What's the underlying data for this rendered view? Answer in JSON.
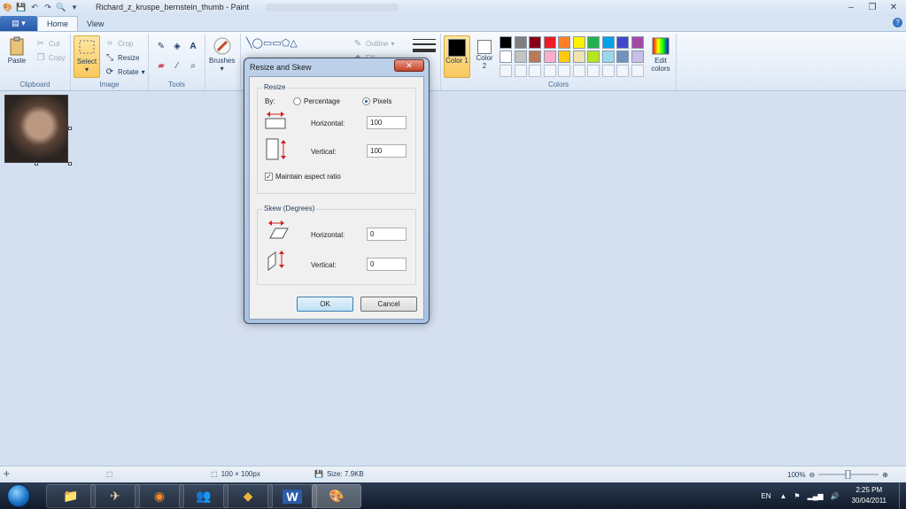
{
  "window": {
    "title": "Richard_z_kruspe_bernstein_thumb - Paint",
    "controls": {
      "minimize": "–",
      "maximize": "❐",
      "close": "✕"
    }
  },
  "tabs": {
    "app_menu": "▤ ▾",
    "home": "Home",
    "view": "View",
    "help": "?"
  },
  "ribbon": {
    "clipboard": {
      "label": "Clipboard",
      "paste": "Paste",
      "cut": "Cut",
      "copy": "Copy"
    },
    "image": {
      "label": "Image",
      "select": "Select",
      "crop": "Crop",
      "resize": "Resize",
      "rotate": "Rotate"
    },
    "tools": {
      "label": "Tools"
    },
    "brushes": {
      "label": "Brushes"
    },
    "shapes": {
      "outline": "Outline",
      "fill": "Fill"
    },
    "colors": {
      "label": "Colors",
      "color1": "Color 1",
      "color2": "Color 2",
      "edit": "Edit colors",
      "palette_row1": [
        "#000000",
        "#7f7f7f",
        "#880015",
        "#ed1c24",
        "#ff7f27",
        "#fff200",
        "#22b14c",
        "#00a2e8",
        "#3f48cc",
        "#a349a4"
      ],
      "palette_row2": [
        "#ffffff",
        "#c3c3c3",
        "#b97a57",
        "#ffaec9",
        "#ffc90e",
        "#efe4b0",
        "#b5e61d",
        "#99d9ea",
        "#7092be",
        "#c8bfe7"
      ]
    }
  },
  "dialog": {
    "title": "Resize and Skew",
    "close": "✕",
    "resize": {
      "legend": "Resize",
      "by": "By:",
      "percentage": "Percentage",
      "pixels": "Pixels",
      "horizontal_label": "Horizontal:",
      "horizontal_value": "100",
      "vertical_label": "Vertical:",
      "vertical_value": "100",
      "maintain": "Maintain aspect ratio"
    },
    "skew": {
      "legend": "Skew (Degrees)",
      "horizontal_label": "Horizontal:",
      "horizontal_value": "0",
      "vertical_label": "Vertical:",
      "vertical_value": "0"
    },
    "ok": "OK",
    "cancel": "Cancel"
  },
  "status": {
    "dimensions": "100 × 100px",
    "size": "Size: 7.9KB",
    "zoom": "100%"
  },
  "taskbar": {
    "lang": "EN",
    "time": "2:25 PM",
    "date": "30/04/2011",
    "word_label": "W"
  }
}
